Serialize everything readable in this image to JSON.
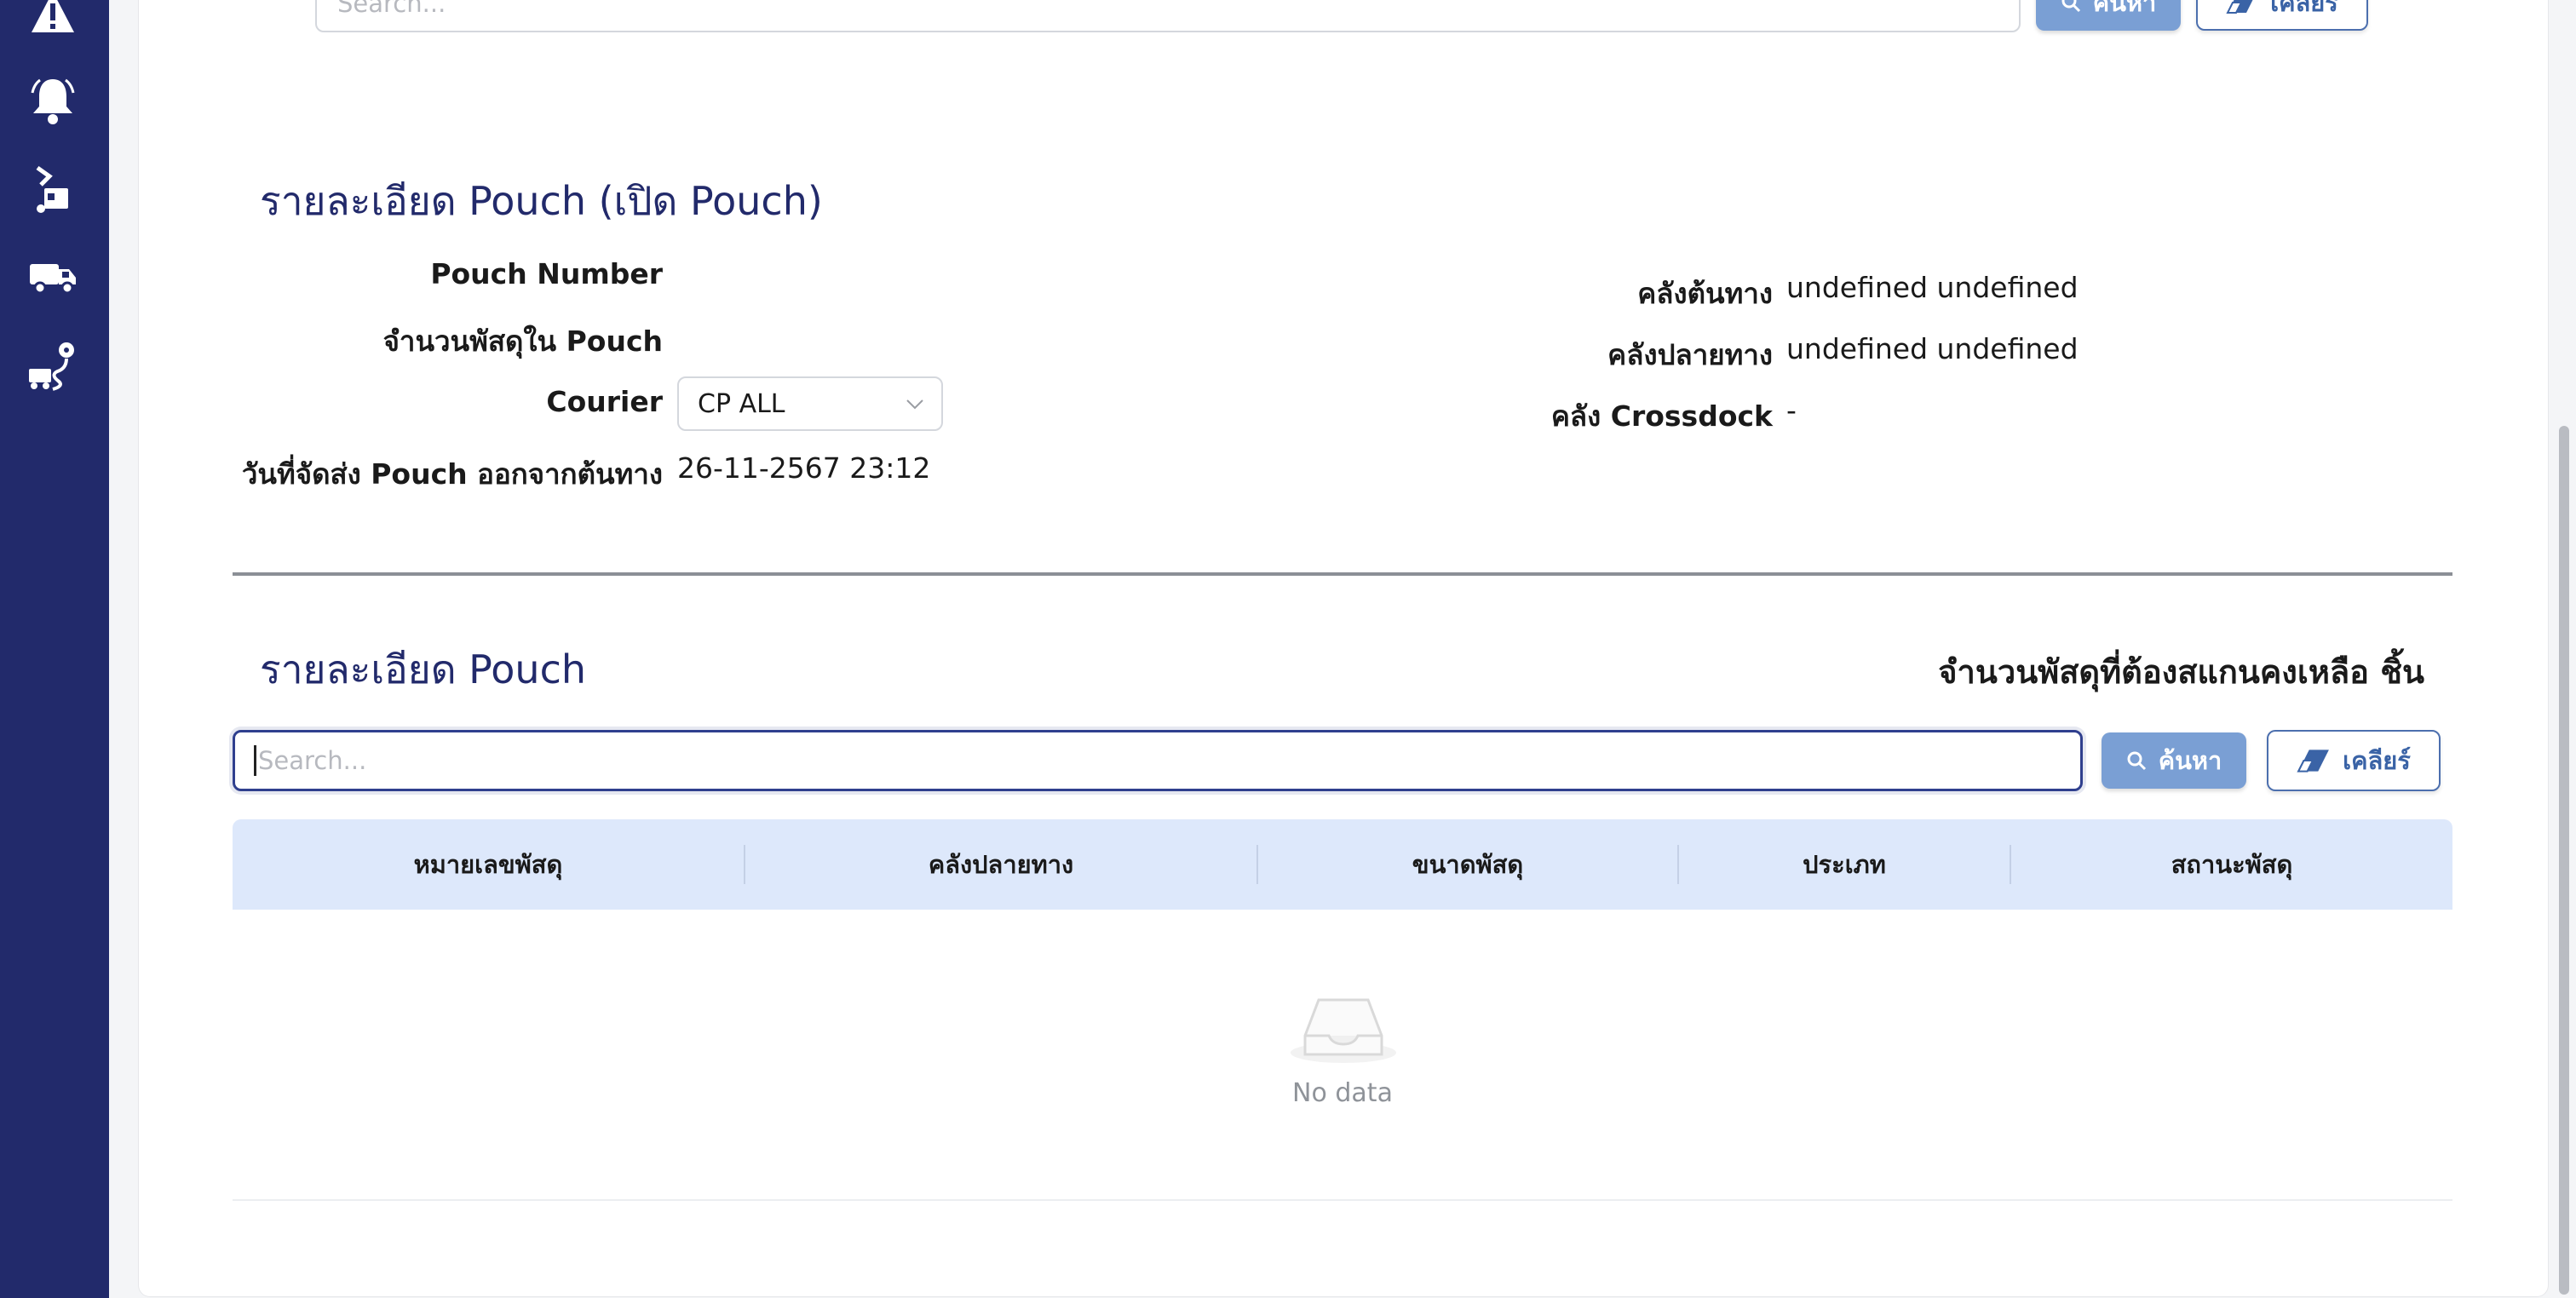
{
  "sidebar": {
    "icons": [
      "warning-icon",
      "bell-icon",
      "hand-truck-icon",
      "delivery-truck-icon",
      "route-icon"
    ]
  },
  "top_search": {
    "placeholder": "Search...",
    "search_label": "ค้นหา",
    "clear_label": "เคลียร์"
  },
  "pouch_open": {
    "title": "รายละเอียด Pouch (เปิด Pouch)",
    "pouch_number_label": "Pouch Number",
    "pouch_number_value": "",
    "parcel_count_label": "จำนวนพัสดุใน Pouch",
    "parcel_count_value": "",
    "courier_label": "Courier",
    "courier_value": "CP ALL",
    "ship_date_label": "วันที่จัดส่ง Pouch ออกจากต้นทาง",
    "ship_date_value": "26-11-2567 23:12",
    "origin_label": "คลังต้นทาง",
    "origin_value": "undefined undefined",
    "destination_label": "คลังปลายทาง",
    "destination_value": "undefined undefined",
    "crossdock_label": "คลัง Crossdock",
    "crossdock_value": "-"
  },
  "pouch_detail": {
    "title": "รายละเอียด Pouch",
    "remaining_text": "จำนวนพัสดุที่ต้องสแกนคงเหลือ ชิ้น",
    "search_placeholder": "Search...",
    "search_label": "ค้นหา",
    "clear_label": "เคลียร์",
    "columns": [
      "หมายเลขพัสดุ",
      "คลังปลายทาง",
      "ขนาดพัสดุ",
      "ประเภท",
      "สถานะพัสดุ"
    ],
    "rows": [],
    "empty_text": "No data"
  },
  "colors": {
    "sidebar": "#222a6b",
    "title": "#222a6b",
    "search_button": "#7a9fd4",
    "clear_button_text": "#3a63a6",
    "table_header": "#dde8fb"
  }
}
